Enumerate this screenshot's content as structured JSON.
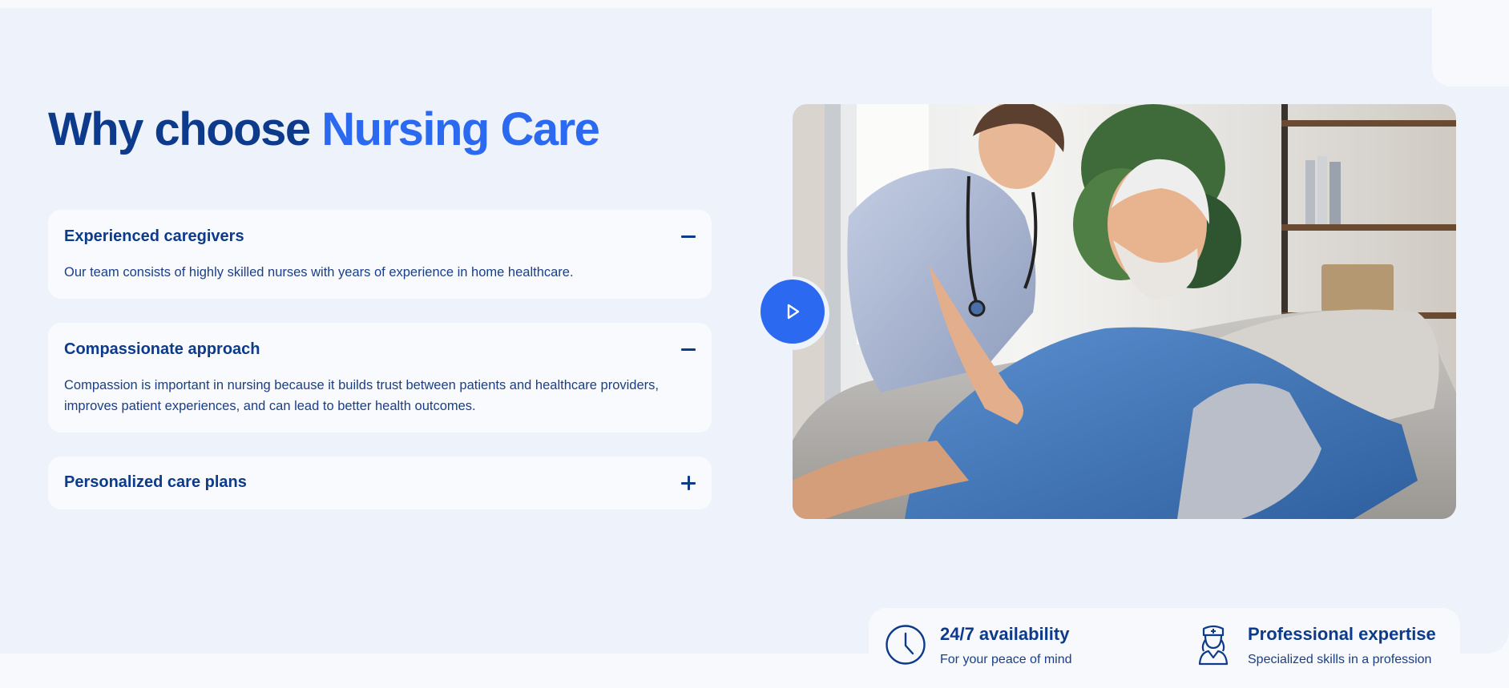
{
  "heading": {
    "part1": "Why choose",
    "accent": "Nursing Care"
  },
  "accordion": [
    {
      "title": "Experienced caregivers",
      "expanded": true,
      "body": "Our team consists of highly skilled nurses with years of experience in home healthcare."
    },
    {
      "title": "Compassionate approach",
      "expanded": true,
      "body": "Compassion is important in nursing because it builds trust between patients and healthcare providers, improves patient experiences, and can lead to better health outcomes."
    },
    {
      "title": "Personalized care plans",
      "expanded": false,
      "body": ""
    }
  ],
  "media": {
    "play_icon": "play-icon"
  },
  "features": [
    {
      "icon": "clock-icon",
      "title": "24/7 availability",
      "subtitle": "For your peace of mind"
    },
    {
      "icon": "nurse-icon",
      "title": "Professional expertise",
      "subtitle": "Specialized skills in a profession"
    }
  ],
  "colors": {
    "primary": "#0d3a8a",
    "accent": "#2a69f0",
    "section_bg": "#eef2fa",
    "card_bg": "#f8fafe"
  }
}
